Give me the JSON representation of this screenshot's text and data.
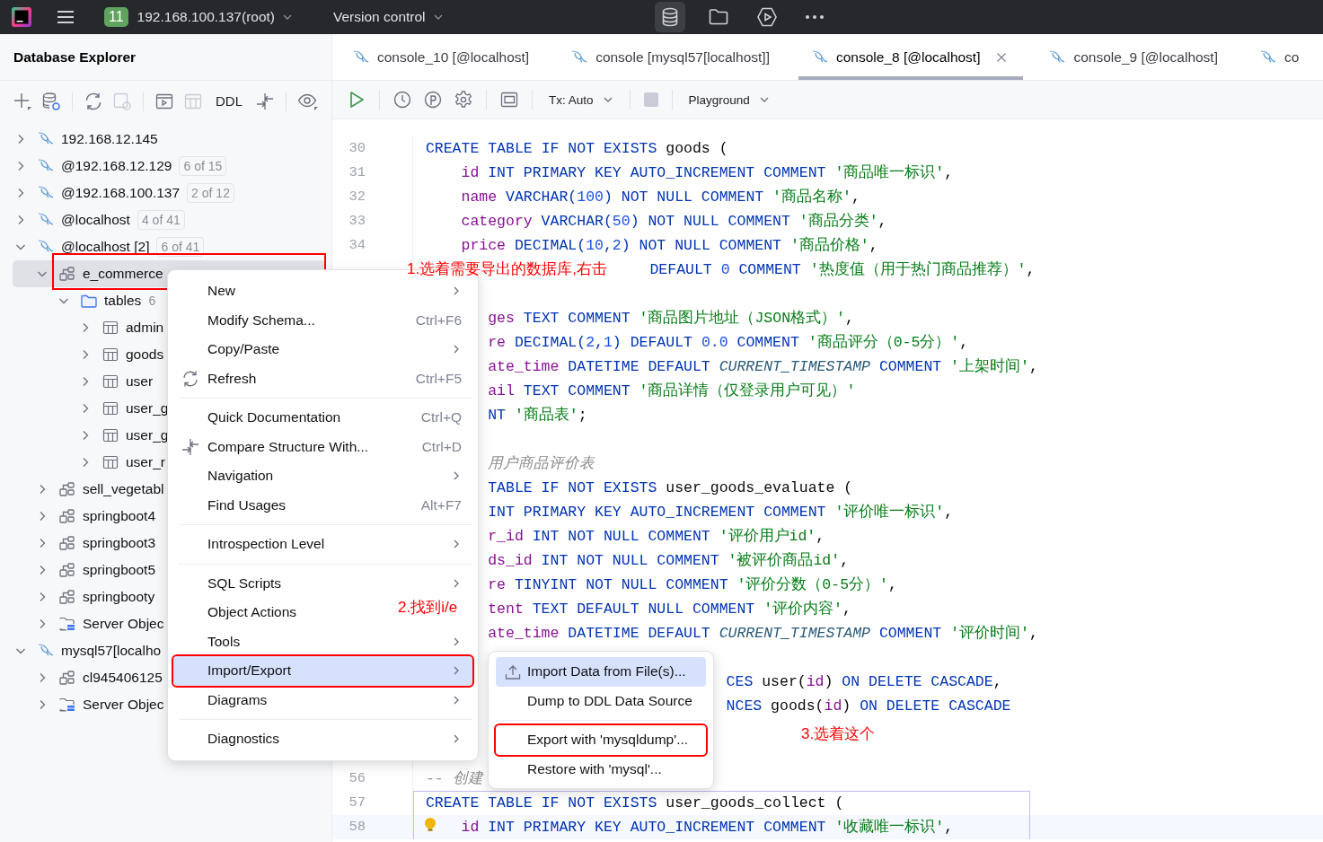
{
  "top_bar": {
    "project_badge": "11",
    "project": "192.168.100.137(root)",
    "vcs": "Version control",
    "tool_windows": [
      {
        "selected": true
      },
      {
        "selected": false
      },
      {
        "selected": false
      }
    ]
  },
  "explorer": {
    "title": "Database Explorer",
    "ddl_label": "DDL",
    "tree": [
      {
        "label": "192.168.12.145",
        "kind": "connection",
        "expanded": false,
        "selected": false
      },
      {
        "label": "@192.168.12.129",
        "kind": "connection",
        "badge": "6 of 15",
        "expanded": false,
        "selected": false
      },
      {
        "label": "@192.168.100.137",
        "kind": "connection",
        "badge": "2 of 12",
        "expanded": false,
        "selected": false
      },
      {
        "label": "@localhost",
        "kind": "connection",
        "badge": "4 of 41",
        "expanded": false,
        "selected": false
      },
      {
        "label": "@localhost [2]",
        "kind": "connection",
        "badge": "6 of 41",
        "expanded": true,
        "selected": false,
        "children": [
          {
            "label": "e_commerce",
            "kind": "schema",
            "expanded": true,
            "selected": true,
            "marked": true,
            "children": [
              {
                "label": "tables",
                "kind": "folder",
                "count": "6",
                "expanded": true,
                "selected": false,
                "children": [
                  {
                    "label": "admin",
                    "kind": "table",
                    "expanded": false,
                    "selected": false
                  },
                  {
                    "label": "goods",
                    "kind": "table",
                    "expanded": false,
                    "selected": false
                  },
                  {
                    "label": "user",
                    "kind": "table",
                    "expanded": false,
                    "selected": false
                  },
                  {
                    "label": "user_g",
                    "kind": "table",
                    "expanded": false,
                    "selected": false
                  },
                  {
                    "label": "user_g",
                    "kind": "table",
                    "expanded": false,
                    "selected": false
                  },
                  {
                    "label": "user_r",
                    "kind": "table",
                    "expanded": false,
                    "selected": false
                  }
                ]
              }
            ]
          },
          {
            "label": "sell_vegetabl",
            "kind": "schema",
            "expanded": false,
            "selected": false
          },
          {
            "label": "springboot4",
            "kind": "schema",
            "expanded": false,
            "selected": false
          },
          {
            "label": "springboot3",
            "kind": "schema",
            "expanded": false,
            "selected": false
          },
          {
            "label": "springboot5",
            "kind": "schema",
            "expanded": false,
            "selected": false
          },
          {
            "label": "springbooty",
            "kind": "schema",
            "expanded": false,
            "selected": false
          },
          {
            "label": "Server Objec",
            "kind": "server",
            "expanded": false,
            "selected": false
          }
        ]
      },
      {
        "label": "mysql57[localho",
        "kind": "connection",
        "expanded": true,
        "selected": false,
        "children": [
          {
            "label": "cl945406125",
            "kind": "schema",
            "expanded": false,
            "selected": false
          },
          {
            "label": "Server Objec",
            "kind": "server",
            "expanded": false,
            "selected": false
          }
        ]
      }
    ]
  },
  "editor": {
    "tabs": [
      {
        "label": "console_10 [@localhost]",
        "selected": false
      },
      {
        "label": "console [mysql57[localhost]]",
        "selected": false
      },
      {
        "label": "console_8 [@localhost]",
        "selected": true
      },
      {
        "label": "console_9 [@localhost]",
        "selected": false
      },
      {
        "label": "co",
        "selected": false
      }
    ],
    "tx_mode": "Tx: Auto",
    "session": "Playground",
    "lines": [
      {
        "number": "30",
        "kind": "full",
        "tokens": [
          {
            "text": "CREATE TABLE IF NOT EXISTS",
            "kind": "k"
          },
          {
            "text": " goods (",
            "kind": "p"
          }
        ]
      },
      {
        "number": "31",
        "kind": "full",
        "indent": true,
        "tokens": [
          {
            "text": "id",
            "kind": "c"
          },
          {
            "text": " INT PRIMARY KEY AUTO_INCREMENT COMMENT ",
            "kind": "k"
          },
          {
            "text": "'商品唯一标识'",
            "kind": "s"
          },
          {
            "text": ",",
            "kind": "p"
          }
        ]
      },
      {
        "number": "32",
        "kind": "full",
        "indent": true,
        "tokens": [
          {
            "text": "name",
            "kind": "c"
          },
          {
            "text": " VARCHAR(",
            "kind": "k"
          },
          {
            "text": "100",
            "kind": "n"
          },
          {
            "text": ") NOT NULL COMMENT ",
            "kind": "k"
          },
          {
            "text": "'商品名称'",
            "kind": "s"
          },
          {
            "text": ",",
            "kind": "p"
          }
        ]
      },
      {
        "number": "33",
        "kind": "full",
        "indent": true,
        "tokens": [
          {
            "text": "category",
            "kind": "c"
          },
          {
            "text": " VARCHAR(",
            "kind": "k"
          },
          {
            "text": "50",
            "kind": "n"
          },
          {
            "text": ") NOT NULL COMMENT ",
            "kind": "k"
          },
          {
            "text": "'商品分类'",
            "kind": "s"
          },
          {
            "text": ",",
            "kind": "p"
          }
        ]
      },
      {
        "number": "34",
        "kind": "full",
        "indent": true,
        "tokens": [
          {
            "text": "price",
            "kind": "c"
          },
          {
            "text": " DECIMAL(",
            "kind": "k"
          },
          {
            "text": "10",
            "kind": "n"
          },
          {
            "text": ",",
            "kind": "k"
          },
          {
            "text": "2",
            "kind": "n"
          },
          {
            "text": ") NOT NULL COMMENT ",
            "kind": "k"
          },
          {
            "text": "'商品价格'",
            "kind": "s"
          },
          {
            "text": ",",
            "kind": "p"
          }
        ]
      },
      {
        "kind": "note",
        "tokens": [
          {
            "text": "DEFAULT ",
            "kind": "k"
          },
          {
            "text": "0",
            "kind": "n"
          },
          {
            "text": " COMMENT ",
            "kind": "k"
          },
          {
            "text": "'热度值（用于热门商品推荐）'",
            "kind": "s"
          },
          {
            "text": ",",
            "kind": "p"
          }
        ]
      },
      {
        "kind": "clipped"
      },
      {
        "kind": "clipped",
        "tokens": [
          {
            "text": "ges",
            "kind": "c"
          },
          {
            "text": " TEXT COMMENT ",
            "kind": "k"
          },
          {
            "text": "'商品图片地址（JSON格式）'",
            "kind": "s"
          },
          {
            "text": ",",
            "kind": "p"
          }
        ]
      },
      {
        "kind": "clipped",
        "tokens": [
          {
            "text": "re",
            "kind": "c"
          },
          {
            "text": " DECIMAL(",
            "kind": "k"
          },
          {
            "text": "2",
            "kind": "n"
          },
          {
            "text": ",",
            "kind": "k"
          },
          {
            "text": "1",
            "kind": "n"
          },
          {
            "text": ") DEFAULT ",
            "kind": "k"
          },
          {
            "text": "0.0",
            "kind": "n"
          },
          {
            "text": " COMMENT ",
            "kind": "k"
          },
          {
            "text": "'商品评分（0-5分）'",
            "kind": "s"
          },
          {
            "text": ",",
            "kind": "p"
          }
        ]
      },
      {
        "kind": "clipped",
        "tokens": [
          {
            "text": "ate_time",
            "kind": "c"
          },
          {
            "text": " DATETIME DEFAULT ",
            "kind": "k"
          },
          {
            "text": "CURRENT_TIMESTAMP",
            "kind": "t"
          },
          {
            "text": " COMMENT ",
            "kind": "k"
          },
          {
            "text": "'上架时间'",
            "kind": "s"
          },
          {
            "text": ",",
            "kind": "p"
          }
        ]
      },
      {
        "kind": "clipped",
        "tokens": [
          {
            "text": "ail",
            "kind": "c"
          },
          {
            "text": " TEXT COMMENT ",
            "kind": "k"
          },
          {
            "text": "'商品详情（仅登录用户可见）'",
            "kind": "s"
          }
        ]
      },
      {
        "kind": "clipped",
        "tokens": [
          {
            "text": "NT ",
            "kind": "k"
          },
          {
            "text": "'商品表'",
            "kind": "s"
          },
          {
            "text": ";",
            "kind": "p"
          }
        ]
      },
      {
        "kind": "clipped"
      },
      {
        "kind": "clipped",
        "tokens": [
          {
            "text": "用户商品评价表",
            "kind": "m"
          }
        ]
      },
      {
        "kind": "clipped",
        "tokens": [
          {
            "text": "TABLE IF NOT EXISTS",
            "kind": "k"
          },
          {
            "text": " user_goods_evaluate (",
            "kind": "p"
          }
        ]
      },
      {
        "kind": "clipped",
        "tokens": [
          {
            "text": "INT PRIMARY KEY AUTO_INCREMENT COMMENT ",
            "kind": "k"
          },
          {
            "text": "'评价唯一标识'",
            "kind": "s"
          },
          {
            "text": ",",
            "kind": "p"
          }
        ]
      },
      {
        "kind": "clipped",
        "tokens": [
          {
            "text": "r_id",
            "kind": "c"
          },
          {
            "text": " INT NOT NULL COMMENT ",
            "kind": "k"
          },
          {
            "text": "'评价用户id'",
            "kind": "s"
          },
          {
            "text": ",",
            "kind": "p"
          }
        ]
      },
      {
        "kind": "clipped",
        "tokens": [
          {
            "text": "ds_id",
            "kind": "c"
          },
          {
            "text": " INT NOT NULL COMMENT ",
            "kind": "k"
          },
          {
            "text": "'被评价商品id'",
            "kind": "s"
          },
          {
            "text": ",",
            "kind": "p"
          }
        ]
      },
      {
        "kind": "clipped",
        "tokens": [
          {
            "text": "re",
            "kind": "c"
          },
          {
            "text": " TINYINT NOT NULL COMMENT ",
            "kind": "k"
          },
          {
            "text": "'评价分数（0-5分）'",
            "kind": "s"
          },
          {
            "text": ",",
            "kind": "p"
          }
        ]
      },
      {
        "kind": "clipped",
        "tokens": [
          {
            "text": "tent",
            "kind": "c"
          },
          {
            "text": " TEXT DEFAULT NULL COMMENT ",
            "kind": "k"
          },
          {
            "text": "'评价内容'",
            "kind": "s"
          },
          {
            "text": ",",
            "kind": "p"
          }
        ]
      },
      {
        "kind": "clipped",
        "tokens": [
          {
            "text": "ate_time",
            "kind": "c"
          },
          {
            "text": " DATETIME DEFAULT ",
            "kind": "k"
          },
          {
            "text": "CURRENT_TIMESTAMP",
            "kind": "t"
          },
          {
            "text": " COMMENT ",
            "kind": "k"
          },
          {
            "text": "'评价时间'",
            "kind": "s"
          },
          {
            "text": ",",
            "kind": "p"
          }
        ]
      },
      {
        "kind": "clipped"
      },
      {
        "kind": "sub",
        "tokens": [
          {
            "text": "CES",
            "kind": "k"
          },
          {
            "text": " user(",
            "kind": "p"
          },
          {
            "text": "id",
            "kind": "c"
          },
          {
            "text": ") ",
            "kind": "p"
          },
          {
            "text": "ON DELETE CASCADE",
            "kind": "k"
          },
          {
            "text": ",",
            "kind": "p"
          }
        ]
      },
      {
        "kind": "sub",
        "tokens": [
          {
            "text": "NCES",
            "kind": "k"
          },
          {
            "text": " goods(",
            "kind": "p"
          },
          {
            "text": "id",
            "kind": "c"
          },
          {
            "text": ") ",
            "kind": "p"
          },
          {
            "text": "ON DELETE CASCADE",
            "kind": "k"
          }
        ]
      },
      {
        "kind": "clipped"
      },
      {
        "kind": "clipped"
      },
      {
        "number": "56",
        "kind": "full",
        "tokens": [
          {
            "text": "-- 创建",
            "kind": "m"
          }
        ]
      },
      {
        "number": "57",
        "kind": "full",
        "statement": true,
        "tokens": [
          {
            "text": "CREATE TABLE IF NOT EXISTS",
            "kind": "k"
          },
          {
            "text": " user_goods_collect (",
            "kind": "p"
          }
        ]
      },
      {
        "number": "58",
        "kind": "full",
        "statement": true,
        "current": true,
        "indent": true,
        "tokens": [
          {
            "text": "id",
            "kind": "c"
          },
          {
            "text": " INT PRIMARY KEY AUTO_INCREMENT COMMENT ",
            "kind": "k"
          },
          {
            "text": "'收藏唯一标识'",
            "kind": "s"
          },
          {
            "text": ",",
            "kind": "p"
          }
        ]
      }
    ]
  },
  "context_menu": {
    "items": [
      {
        "kind": "item",
        "label": "New",
        "submenu": true,
        "selected": false
      },
      {
        "kind": "item",
        "label": "Modify Schema...",
        "shortcut": "Ctrl+F6",
        "submenu": false,
        "selected": false
      },
      {
        "kind": "item",
        "label": "Copy/Paste",
        "submenu": true,
        "selected": false
      },
      {
        "kind": "item",
        "label": "Refresh",
        "shortcut": "Ctrl+F5",
        "submenu": false,
        "selected": false
      },
      {
        "kind": "separator"
      },
      {
        "kind": "item",
        "label": "Quick Documentation",
        "shortcut": "Ctrl+Q",
        "submenu": false,
        "selected": false
      },
      {
        "kind": "item",
        "label": "Compare Structure With...",
        "shortcut": "Ctrl+D",
        "submenu": false,
        "selected": false
      },
      {
        "kind": "item",
        "label": "Navigation",
        "submenu": true,
        "selected": false
      },
      {
        "kind": "item",
        "label": "Find Usages",
        "shortcut": "Alt+F7",
        "submenu": false,
        "selected": false
      },
      {
        "kind": "separator"
      },
      {
        "kind": "item",
        "label": "Introspection Level",
        "submenu": true,
        "selected": false
      },
      {
        "kind": "separator"
      },
      {
        "kind": "item",
        "label": "SQL Scripts",
        "submenu": true,
        "selected": false
      },
      {
        "kind": "item",
        "label": "Object Actions",
        "submenu": false,
        "selected": false
      },
      {
        "kind": "item",
        "label": "Tools",
        "submenu": true,
        "selected": false
      },
      {
        "kind": "item",
        "label": "Import/Export",
        "submenu": true,
        "selected": true,
        "marked": true
      },
      {
        "kind": "item",
        "label": "Diagrams",
        "submenu": true,
        "selected": false
      },
      {
        "kind": "separator"
      },
      {
        "kind": "item",
        "label": "Diagnostics",
        "submenu": true,
        "selected": false
      }
    ]
  },
  "submenu": {
    "items": [
      {
        "kind": "item",
        "label": "Import Data from File(s)...",
        "selected": true
      },
      {
        "kind": "item",
        "label": "Dump to DDL Data Source",
        "selected": false
      },
      {
        "kind": "separator"
      },
      {
        "kind": "item",
        "label": "Export with 'mysqldump'...",
        "selected": false,
        "marked": true
      },
      {
        "kind": "item",
        "label": "Restore with 'mysql'...",
        "selected": false
      }
    ]
  },
  "annotations": [
    {
      "text": "1.选着需要导出的数据库,右击"
    },
    {
      "text": "2.找到i/e"
    },
    {
      "text": "3.选着这个"
    }
  ]
}
